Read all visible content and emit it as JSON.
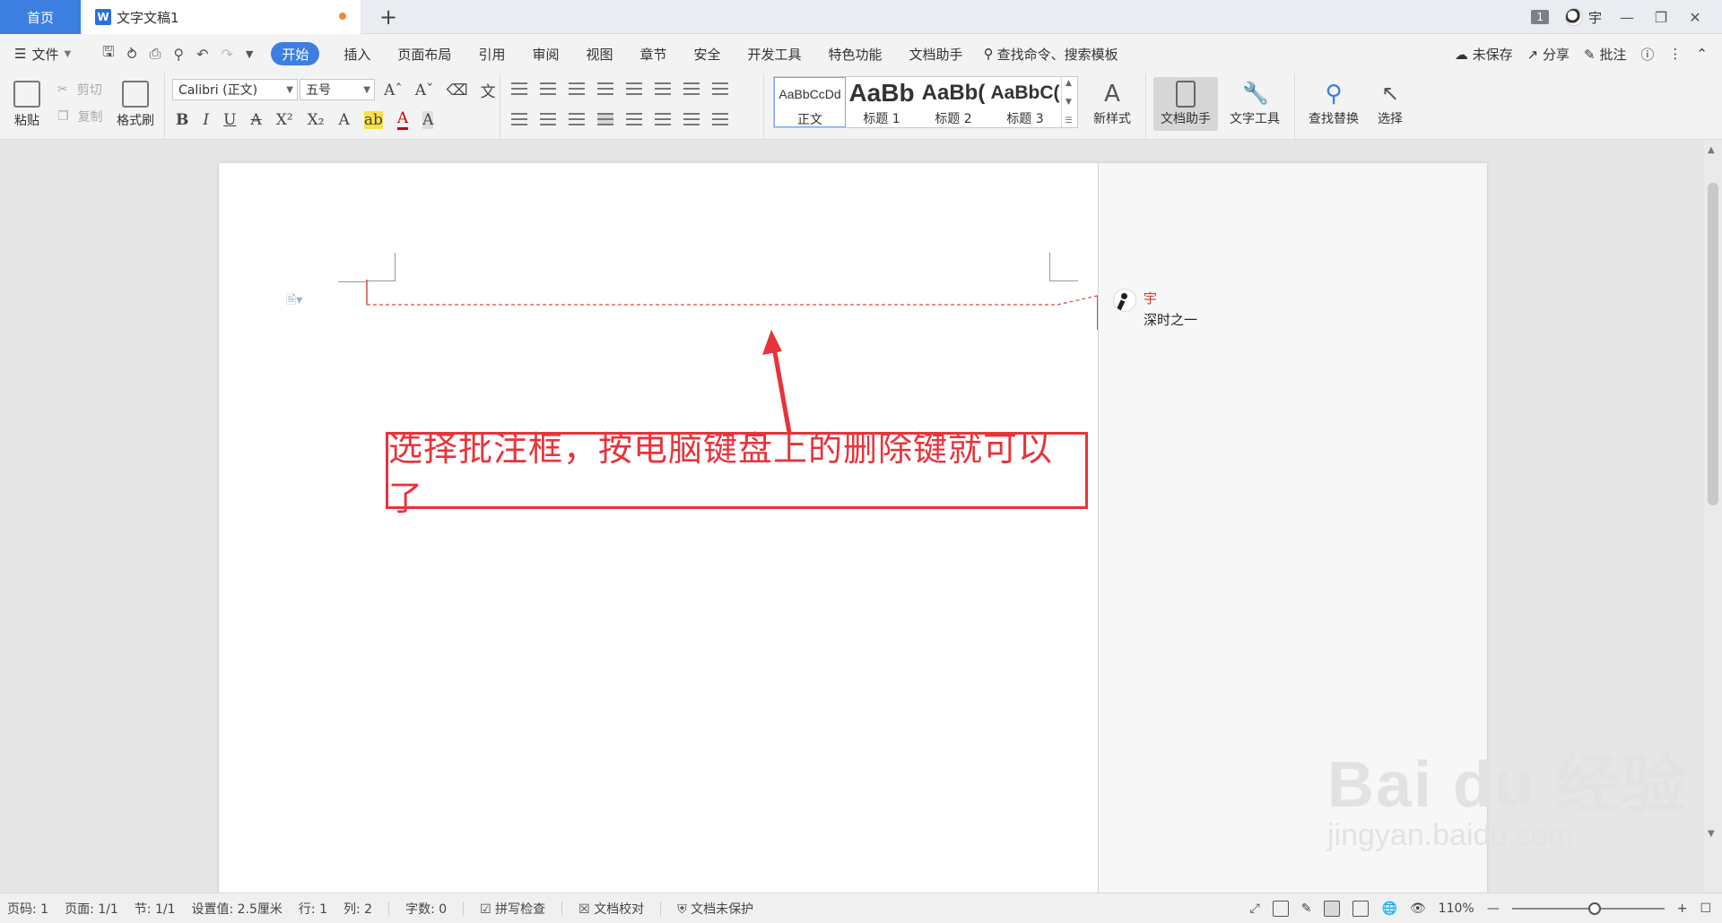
{
  "tabbar": {
    "home_label": "首页",
    "doc_title": "文字文稿1",
    "add_label": "+",
    "page_badge": "1",
    "user_name": "宇"
  },
  "menubar": {
    "file_label": "文件",
    "tabs": [
      "开始",
      "插入",
      "页面布局",
      "引用",
      "审阅",
      "视图",
      "章节",
      "安全",
      "开发工具",
      "特色功能",
      "文档助手"
    ],
    "search_label": "查找命令、搜索模板",
    "unsaved_label": "未保存",
    "share_label": "分享",
    "comment_label": "批注"
  },
  "ribbon": {
    "paste_label": "粘贴",
    "cut_label": "剪切",
    "copy_label": "复制",
    "format_painter_label": "格式刷",
    "font_name": "Calibri (正文)",
    "font_size": "五号",
    "styles": [
      {
        "preview": "AaBbCcDd",
        "label": "正文"
      },
      {
        "preview": "AaBb",
        "label": "标题 1"
      },
      {
        "preview": "AaBb(",
        "label": "标题 2"
      },
      {
        "preview": "AaBbC(",
        "label": "标题 3"
      }
    ],
    "new_style_label": "新样式",
    "doc_assistant_label": "文档助手",
    "text_tools_label": "文字工具",
    "find_replace_label": "查找替换",
    "select_label": "选择"
  },
  "document": {
    "comment_author": "宇",
    "comment_text": "深时之一",
    "annotation_text": "选择批注框，按电脑键盘上的删除键就可以了",
    "watermark_main": "Bai du 经验",
    "watermark_sub": "jingyan.baidu.com"
  },
  "statusbar": {
    "page_no": "页码: 1",
    "page_count": "页面: 1/1",
    "section": "节: 1/1",
    "setting": "设置值: 2.5厘米",
    "row": "行: 1",
    "col": "列: 2",
    "word_count": "字数: 0",
    "spell_check": "拼写检查",
    "proofread": "文档校对",
    "protect": "文档未保护",
    "zoom": "110%"
  },
  "colors": {
    "accent": "#3d7fe0",
    "annotation_red": "#e8333a",
    "comment_line": "#d94a4a"
  }
}
